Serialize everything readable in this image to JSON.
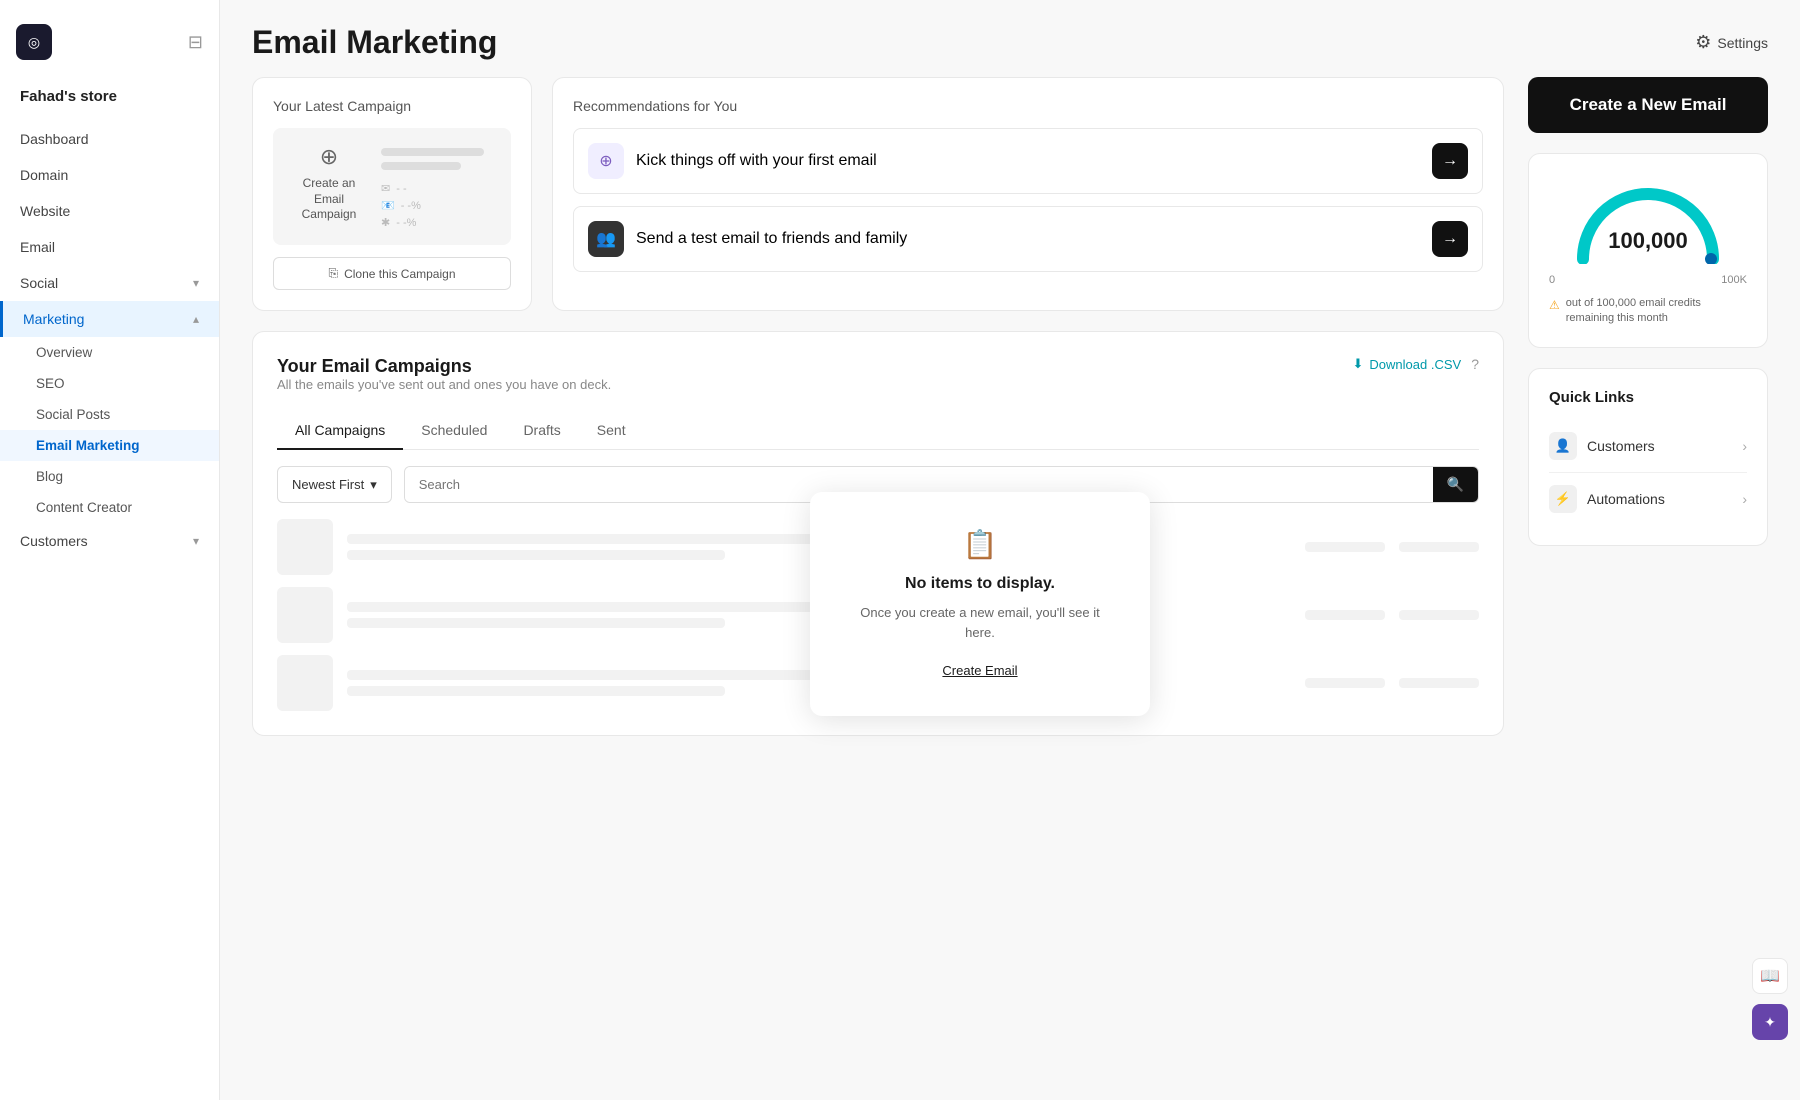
{
  "sidebar": {
    "store_name": "Fahad's store",
    "nav_items": [
      {
        "label": "Dashboard",
        "active": false,
        "sub": []
      },
      {
        "label": "Domain",
        "active": false,
        "sub": []
      },
      {
        "label": "Website",
        "active": false,
        "sub": []
      },
      {
        "label": "Email",
        "active": false,
        "sub": []
      },
      {
        "label": "Social",
        "active": false,
        "chevron": true,
        "sub": []
      },
      {
        "label": "Marketing",
        "active": true,
        "chevron": true,
        "sub": [
          "Overview",
          "SEO",
          "Social Posts",
          "Email Marketing",
          "Blog",
          "Content Creator"
        ]
      },
      {
        "label": "Customers",
        "active": false,
        "chevron": true,
        "sub": []
      }
    ]
  },
  "header": {
    "title": "Email Marketing",
    "settings_label": "Settings"
  },
  "latest_campaign": {
    "section_label": "Your Latest Campaign",
    "card_icon": "⊕",
    "card_title": "Create an Email Campaign",
    "clone_btn_label": "Clone this Campaign"
  },
  "recommendations": {
    "section_label": "Recommendations for You",
    "items": [
      {
        "icon": "⊕",
        "icon_type": "light",
        "text": "Kick things off with your first email"
      },
      {
        "icon": "👥",
        "icon_type": "dark",
        "text": "Send a test email to friends and family"
      }
    ]
  },
  "campaigns": {
    "title": "Your Email Campaigns",
    "subtitle": "All the emails you've sent out and ones you have on deck.",
    "download_csv": "Download .CSV",
    "tabs": [
      "All Campaigns",
      "Scheduled",
      "Drafts",
      "Sent"
    ],
    "active_tab": "All Campaigns",
    "sort_label": "Newest First",
    "search_placeholder": "Search",
    "empty_title": "No items to display.",
    "empty_sub": "Once you create a new email, you'll see it here.",
    "create_email_link": "Create Email"
  },
  "right_panel": {
    "create_btn_label": "Create a New Email",
    "credits": {
      "value": "100,000",
      "min_label": "0",
      "max_label": "100K",
      "warning_text": "out of 100,000 email credits remaining this month"
    },
    "quick_links": {
      "title": "Quick Links",
      "items": [
        {
          "icon": "👤",
          "label": "Customers"
        },
        {
          "icon": "⚡",
          "label": "Automations"
        }
      ]
    }
  }
}
